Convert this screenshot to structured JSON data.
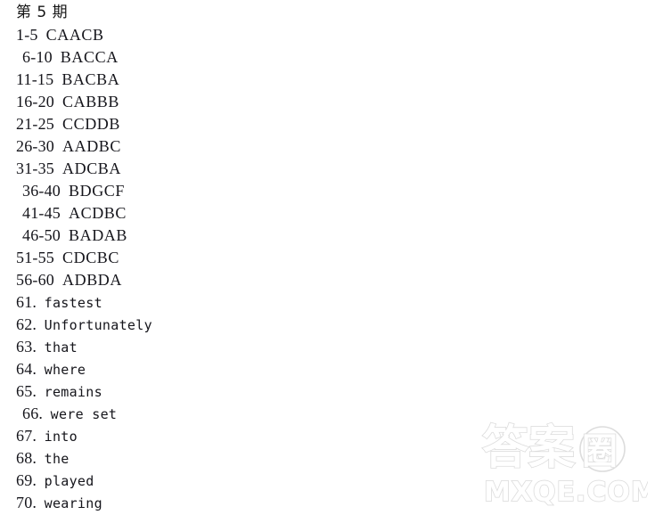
{
  "page": {
    "background_color": "#ffffff",
    "text_color": "#15151b",
    "heading": "第 5 期"
  },
  "answer_key": {
    "multiple_choice": [
      {
        "range": "1-5",
        "letters": "CAACB",
        "indent": 18
      },
      {
        "range": "6-10",
        "letters": "BACCA",
        "indent": 25
      },
      {
        "range": "11-15",
        "letters": "BACBA",
        "indent": 18
      },
      {
        "range": "16-20",
        "letters": "CABBB",
        "indent": 18
      },
      {
        "range": "21-25",
        "letters": "CCDDB",
        "indent": 18
      },
      {
        "range": "26-30",
        "letters": "AADBC",
        "indent": 18
      },
      {
        "range": "31-35",
        "letters": "ADCBA",
        "indent": 18
      },
      {
        "range": "36-40",
        "letters": "BDGCF",
        "indent": 25
      },
      {
        "range": "41-45",
        "letters": "ACDBC",
        "indent": 25
      },
      {
        "range": "46-50",
        "letters": "BADAB",
        "indent": 25
      },
      {
        "range": "51-55",
        "letters": "CDCBC",
        "indent": 18
      },
      {
        "range": "56-60",
        "letters": "ADBDA",
        "indent": 18
      }
    ],
    "fill_in_blanks": [
      {
        "num": "61.",
        "word": "fastest",
        "indent": 18
      },
      {
        "num": "62.",
        "word": "Unfortunately",
        "indent": 18
      },
      {
        "num": "63.",
        "word": "that",
        "indent": 18
      },
      {
        "num": "64.",
        "word": "where",
        "indent": 18
      },
      {
        "num": "65.",
        "word": "remains",
        "indent": 18
      },
      {
        "num": "66.",
        "word": "were set",
        "indent": 25
      },
      {
        "num": "67.",
        "word": "into",
        "indent": 18
      },
      {
        "num": "68.",
        "word": "the",
        "indent": 18
      },
      {
        "num": "69.",
        "word": "played",
        "indent": 18
      },
      {
        "num": "70.",
        "word": "wearing",
        "indent": 18
      }
    ]
  },
  "watermark": {
    "logo_text": "答案",
    "logo_circled_char": "圈",
    "domain_text": "MXQE.COM",
    "color": "#dcdcdc"
  }
}
